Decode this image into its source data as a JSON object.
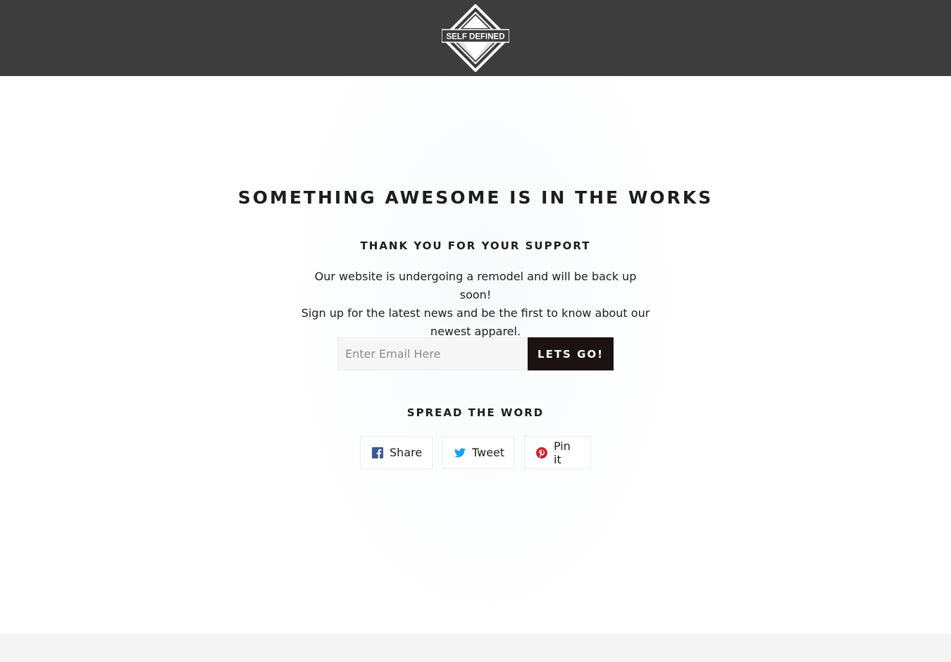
{
  "header": {
    "logo_text": "SELF DEFINED",
    "background_color": "#3d3d3d"
  },
  "main": {
    "headline": "Something awesome is in the works",
    "subheading": "Thank you for your support",
    "body_lines": [
      "Our website is undergoing a remodel and will be back up soon!",
      "Sign up for the latest news and be the first to know about our",
      "newest apparel."
    ],
    "signup": {
      "email_placeholder": "Enter Email Here",
      "email_value": "",
      "submit_label": "Lets go!"
    },
    "spread_heading": "Spread the word",
    "share_buttons": [
      {
        "label": "Share",
        "icon": "facebook-icon",
        "color": "#3b5998"
      },
      {
        "label": "Tweet",
        "icon": "twitter-icon",
        "color": "#1da1f2"
      },
      {
        "label": "Pin it",
        "icon": "pinterest-icon",
        "color": "#cb2027"
      }
    ]
  },
  "colors": {
    "accent_button": "#1c1212",
    "text": "#1c1d1d",
    "footer": "#f4f4f4"
  }
}
